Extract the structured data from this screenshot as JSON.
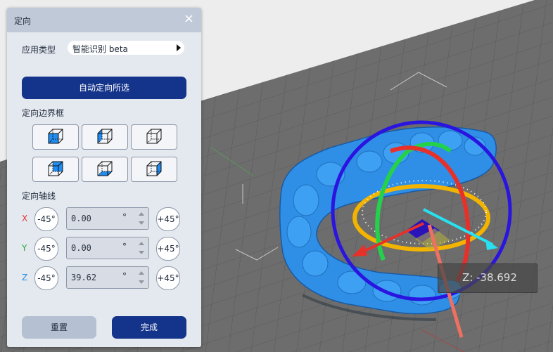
{
  "panel": {
    "title": "定向",
    "close_icon": "×",
    "app_type_label": "应用类型",
    "app_type_value": "智能识别 beta",
    "auto_orient_button": "自动定向所选",
    "bounding_box_label": "定向边界框",
    "axis_label": "定向轴线",
    "axes": [
      {
        "name": "X",
        "color": "#e23a3a",
        "minus_label": "-45°",
        "plus_label": "+45°",
        "value": "0.00",
        "unit": "°"
      },
      {
        "name": "Y",
        "color": "#27a83a",
        "minus_label": "-45°",
        "plus_label": "+45°",
        "value": "0.00",
        "unit": "°"
      },
      {
        "name": "Z",
        "color": "#2a8fe0",
        "minus_label": "-45°",
        "plus_label": "+45°",
        "value": "39.62",
        "unit": "°"
      }
    ],
    "reset_button": "重置",
    "done_button": "完成"
  },
  "viewport": {
    "z_readout_label": "Z:",
    "z_readout_value": "-38.692"
  },
  "colors": {
    "accent": "#14338a",
    "model": "#2f8fe6",
    "gizmo_ring": "#2a14e0"
  }
}
